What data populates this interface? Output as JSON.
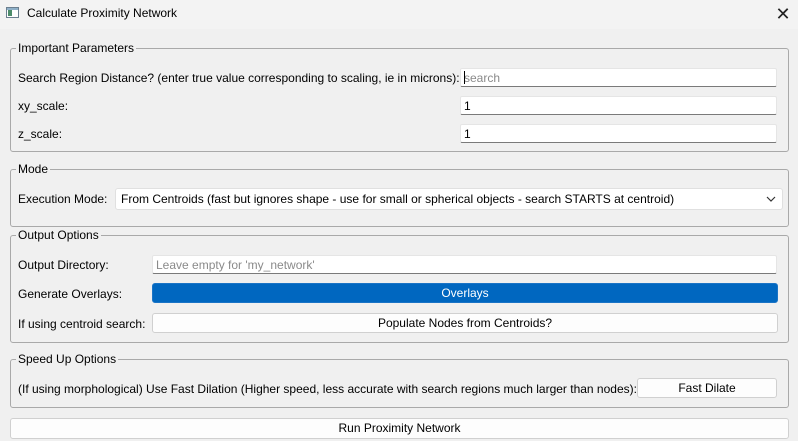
{
  "window": {
    "title": "Calculate Proximity Network",
    "close_glyph": "✕",
    "icon": "app-window-icon"
  },
  "important": {
    "title": "Important Parameters",
    "search_label": "Search Region Distance? (enter true value corresponding to scaling, ie in microns):",
    "search_placeholder": "search",
    "search_value": "",
    "xy_label": "xy_scale:",
    "xy_value": "1",
    "z_label": "z_scale:",
    "z_value": "1"
  },
  "mode": {
    "title": "Mode",
    "exec_label": "Execution Mode:",
    "exec_value": "From Centroids (fast but ignores shape - use for small or spherical objects - search STARTS at centroid)"
  },
  "output": {
    "title": "Output Options",
    "dir_label": "Output Directory:",
    "dir_placeholder": "Leave empty for 'my_network'",
    "overlays_label": "Generate Overlays:",
    "overlays_button": "Overlays",
    "centroid_label": "If using centroid search:",
    "populate_button": "Populate Nodes from Centroids?"
  },
  "speed": {
    "title": "Speed Up Options",
    "fast_label": "(If using morphological) Use Fast Dilation (Higher speed, less accurate with search regions much larger than nodes):",
    "fast_button": "Fast Dilate"
  },
  "run_button": "Run Proximity Network",
  "colors": {
    "accent": "#0067c0",
    "background": "#f0f0f0"
  }
}
